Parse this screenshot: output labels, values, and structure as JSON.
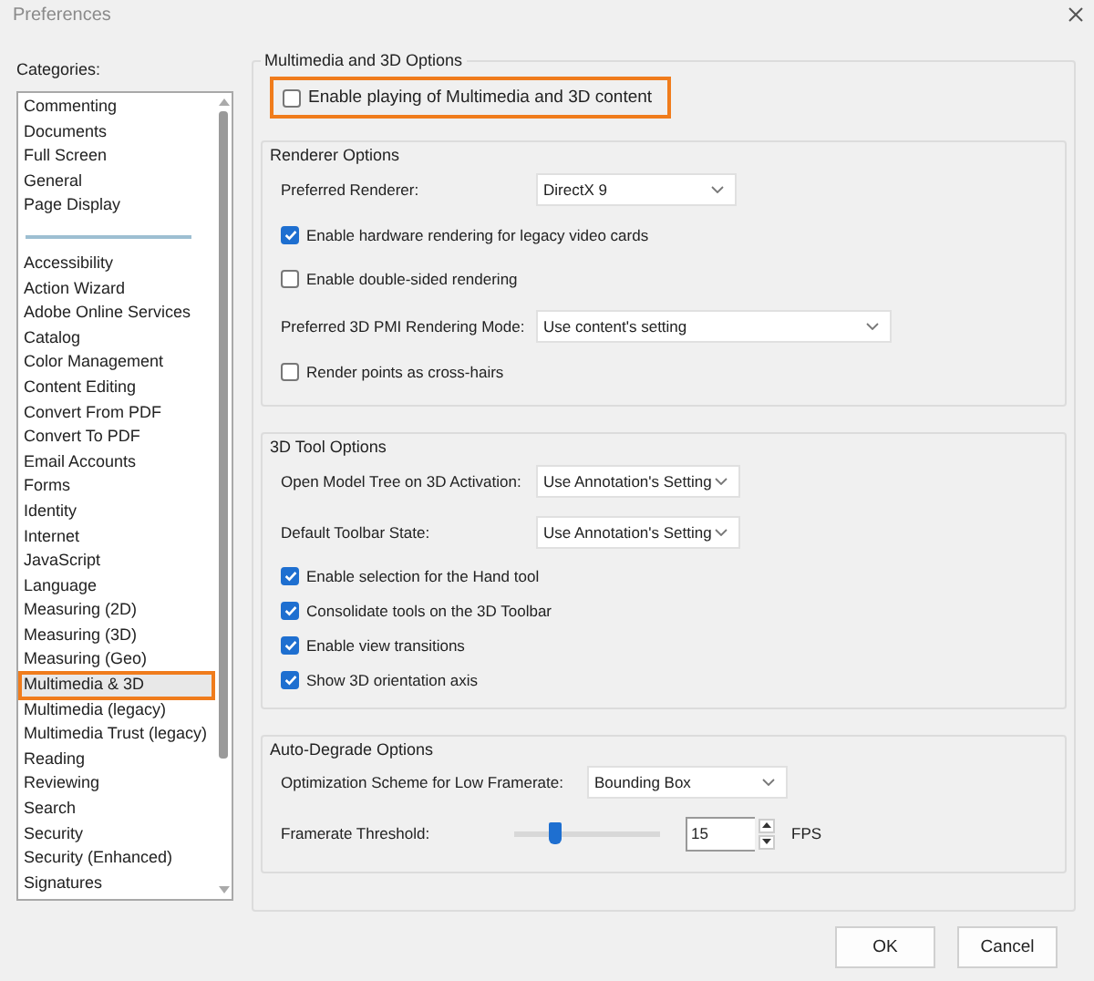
{
  "window": {
    "title": "Preferences"
  },
  "categories": {
    "label": "Categories:",
    "groups": [
      [
        {
          "label": "Commenting",
          "selected": false
        },
        {
          "label": "Documents",
          "selected": false
        },
        {
          "label": "Full Screen",
          "selected": false
        },
        {
          "label": "General",
          "selected": false
        },
        {
          "label": "Page Display",
          "selected": false
        }
      ],
      [
        {
          "label": "Accessibility",
          "selected": false
        },
        {
          "label": "Action Wizard",
          "selected": false
        },
        {
          "label": "Adobe Online Services",
          "selected": false
        },
        {
          "label": "Catalog",
          "selected": false
        },
        {
          "label": "Color Management",
          "selected": false
        },
        {
          "label": "Content Editing",
          "selected": false
        },
        {
          "label": "Convert From PDF",
          "selected": false
        },
        {
          "label": "Convert To PDF",
          "selected": false
        },
        {
          "label": "Email Accounts",
          "selected": false
        },
        {
          "label": "Forms",
          "selected": false
        },
        {
          "label": "Identity",
          "selected": false
        },
        {
          "label": "Internet",
          "selected": false
        },
        {
          "label": "JavaScript",
          "selected": false
        },
        {
          "label": "Language",
          "selected": false
        },
        {
          "label": "Measuring (2D)",
          "selected": false
        },
        {
          "label": "Measuring (3D)",
          "selected": false
        },
        {
          "label": "Measuring (Geo)",
          "selected": false
        },
        {
          "label": "Multimedia & 3D",
          "selected": true,
          "highlighted": true
        },
        {
          "label": "Multimedia (legacy)",
          "selected": false
        },
        {
          "label": "Multimedia Trust (legacy)",
          "selected": false
        },
        {
          "label": "Reading",
          "selected": false
        },
        {
          "label": "Reviewing",
          "selected": false
        },
        {
          "label": "Search",
          "selected": false
        },
        {
          "label": "Security",
          "selected": false
        },
        {
          "label": "Security (Enhanced)",
          "selected": false
        },
        {
          "label": "Signatures",
          "selected": false
        }
      ]
    ]
  },
  "options": {
    "title": "Multimedia and 3D Options",
    "enable": {
      "label": "Enable playing of Multimedia and 3D content",
      "checked": false,
      "highlighted": true
    },
    "sections": [
      {
        "title": "Renderer Options",
        "rows": [
          {
            "kind": "dropdown",
            "label": "Preferred Renderer:",
            "value": "DirectX 9"
          },
          {
            "kind": "checkbox",
            "label": "Enable hardware rendering for legacy video cards",
            "checked": true
          },
          {
            "kind": "checkbox",
            "label": "Enable double-sided rendering",
            "checked": false
          },
          {
            "kind": "dropdown",
            "label": "Preferred 3D PMI Rendering Mode:",
            "value": "Use content's setting"
          },
          {
            "kind": "checkbox",
            "label": "Render points as cross-hairs",
            "checked": false
          }
        ]
      },
      {
        "title": "3D Tool Options",
        "rows": [
          {
            "kind": "dropdown",
            "label": "Open Model Tree on 3D Activation:",
            "value": "Use Annotation's Setting"
          },
          {
            "kind": "dropdown",
            "label": "Default Toolbar State:",
            "value": "Use Annotation's Setting"
          },
          {
            "kind": "checkbox",
            "label": "Enable selection for the Hand tool",
            "checked": true
          },
          {
            "kind": "checkbox",
            "label": "Consolidate tools on the 3D Toolbar",
            "checked": true
          },
          {
            "kind": "checkbox",
            "label": "Enable view transitions",
            "checked": true
          },
          {
            "kind": "checkbox",
            "label": "Show 3D orientation axis",
            "checked": true
          }
        ]
      },
      {
        "title": "Auto-Degrade Options",
        "rows": [
          {
            "kind": "dropdown",
            "label": "Optimization Scheme for Low Framerate:",
            "value": "Bounding Box"
          },
          {
            "kind": "slider",
            "label": "Framerate Threshold:",
            "level": 0.27,
            "value": "15",
            "unit": "FPS"
          }
        ]
      }
    ]
  },
  "buttons": [
    "OK",
    "Cancel"
  ]
}
